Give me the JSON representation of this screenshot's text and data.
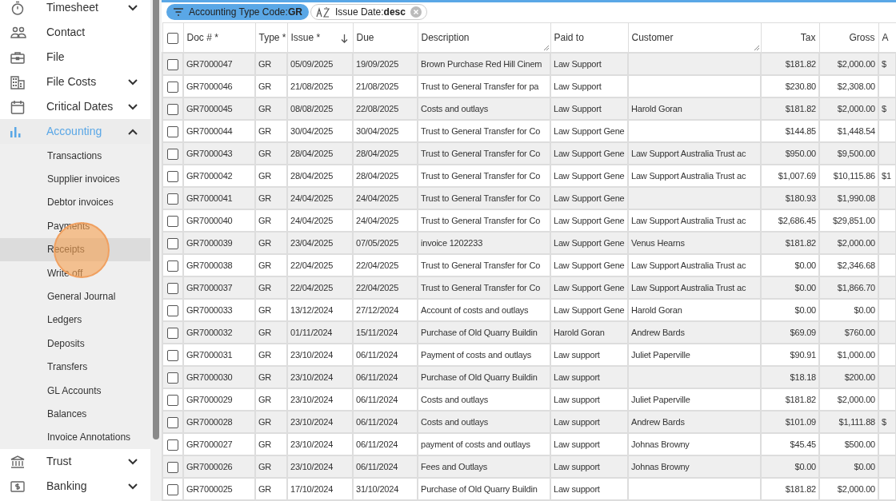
{
  "sidebar": {
    "items": [
      {
        "label": "Timesheet",
        "selected": false,
        "expanded": false
      },
      {
        "label": "Contact",
        "selected": false
      },
      {
        "label": "File",
        "selected": false
      },
      {
        "label": "File Costs",
        "selected": false,
        "expanded": false
      },
      {
        "label": "Critical Dates",
        "selected": false,
        "expanded": false
      },
      {
        "label": "Accounting",
        "selected": true,
        "expanded": true,
        "children": [
          {
            "label": "Transactions",
            "selected": false
          },
          {
            "label": "Supplier invoices",
            "selected": false
          },
          {
            "label": "Debtor invoices",
            "selected": false
          },
          {
            "label": "Payments",
            "selected": false
          },
          {
            "label": "Receipts",
            "selected": true
          },
          {
            "label": "Write off",
            "selected": false
          },
          {
            "label": "General Journal",
            "selected": false
          },
          {
            "label": "Ledgers",
            "selected": false
          },
          {
            "label": "Deposits",
            "selected": false
          },
          {
            "label": "Transfers",
            "selected": false
          },
          {
            "label": "GL Accounts",
            "selected": false
          },
          {
            "label": "Balances",
            "selected": false
          },
          {
            "label": "Invoice Annotations",
            "selected": false
          }
        ]
      },
      {
        "label": "Trust",
        "selected": false,
        "expanded": false
      },
      {
        "label": "Banking",
        "selected": false,
        "expanded": false
      }
    ]
  },
  "chips": [
    {
      "kind": "filter",
      "label": "Accounting Type Code:",
      "value": "GR"
    },
    {
      "kind": "sort",
      "label": "Issue Date:",
      "value": "desc"
    }
  ],
  "table": {
    "header_checked": false,
    "columns": [
      {
        "label": "Doc # *",
        "kind": "text",
        "sorted": false,
        "resizable": false
      },
      {
        "label": "Type *",
        "kind": "text",
        "sorted": false,
        "resizable": false
      },
      {
        "label": "Issue *",
        "kind": "text",
        "sorted": true,
        "resizable": false
      },
      {
        "label": "Due",
        "kind": "text",
        "sorted": false,
        "resizable": false
      },
      {
        "label": "Description",
        "kind": "text",
        "sorted": false,
        "resizable": true
      },
      {
        "label": "Paid to",
        "kind": "text",
        "sorted": false,
        "resizable": false
      },
      {
        "label": "Customer",
        "kind": "text",
        "sorted": false,
        "resizable": true
      },
      {
        "label": "Tax",
        "kind": "money",
        "sorted": false,
        "resizable": false
      },
      {
        "label": "Gross",
        "kind": "money",
        "sorted": false,
        "resizable": false
      },
      {
        "label": "A",
        "kind": "text",
        "sorted": false,
        "resizable": false
      }
    ],
    "rows": [
      {
        "checked": false,
        "cells": [
          "GR7000047",
          "GR",
          "05/09/2025",
          "19/09/2025",
          "Brown Purchase Red Hill Cinem",
          "Law Support",
          "",
          "$181.82",
          "$2,000.00",
          "$"
        ]
      },
      {
        "checked": false,
        "cells": [
          "GR7000046",
          "GR",
          "21/08/2025",
          "21/08/2025",
          "Trust to General Transfer for pa",
          "Law Support",
          "",
          "$230.80",
          "$2,308.00",
          ""
        ]
      },
      {
        "checked": false,
        "cells": [
          "GR7000045",
          "GR",
          "08/08/2025",
          "22/08/2025",
          "Costs and outlays",
          "Law Support",
          "Harold Goran",
          "$181.82",
          "$2,000.00",
          "$"
        ]
      },
      {
        "checked": false,
        "cells": [
          "GR7000044",
          "GR",
          "30/04/2025",
          "30/04/2025",
          "Trust to General Transfer for Co",
          "Law Support Gene",
          "",
          "$144.85",
          "$1,448.54",
          ""
        ]
      },
      {
        "checked": false,
        "cells": [
          "GR7000043",
          "GR",
          "28/04/2025",
          "28/04/2025",
          "Trust to General Transfer for Co",
          "Law Support Gene",
          "Law Support Australia Trust ac",
          "$950.00",
          "$9,500.00",
          ""
        ]
      },
      {
        "checked": false,
        "cells": [
          "GR7000042",
          "GR",
          "28/04/2025",
          "28/04/2025",
          "Trust to General Transfer for Co",
          "Law Support Gene",
          "Law Support Australia Trust ac",
          "$1,007.69",
          "$10,115.86",
          "$1"
        ]
      },
      {
        "checked": false,
        "cells": [
          "GR7000041",
          "GR",
          "24/04/2025",
          "24/04/2025",
          "Trust to General Transfer for Co",
          "Law Support Gene",
          "",
          "$180.93",
          "$1,990.08",
          ""
        ]
      },
      {
        "checked": false,
        "cells": [
          "GR7000040",
          "GR",
          "24/04/2025",
          "24/04/2025",
          "Trust to General Transfer for Co",
          "Law Support Gene",
          "Law Support Australia Trust ac",
          "$2,686.45",
          "$29,851.00",
          ""
        ]
      },
      {
        "checked": false,
        "cells": [
          "GR7000039",
          "GR",
          "23/04/2025",
          "07/05/2025",
          "invoice 1202233",
          "Law Support Gene",
          "Venus Hearns",
          "$181.82",
          "$2,000.00",
          ""
        ]
      },
      {
        "checked": false,
        "cells": [
          "GR7000038",
          "GR",
          "22/04/2025",
          "22/04/2025",
          "Trust to General Transfer for Co",
          "Law Support Gene",
          "Law Support Australia Trust ac",
          "$0.00",
          "$2,346.68",
          ""
        ]
      },
      {
        "checked": false,
        "cells": [
          "GR7000037",
          "GR",
          "22/04/2025",
          "22/04/2025",
          "Trust to General Transfer for Co",
          "Law Support Gene",
          "Law Support Australia Trust ac",
          "$0.00",
          "$1,866.70",
          ""
        ]
      },
      {
        "checked": false,
        "cells": [
          "GR7000033",
          "GR",
          "13/12/2024",
          "27/12/2024",
          "Account of costs and outlays",
          "Law Support Gene",
          "Harold Goran",
          "$0.00",
          "$0.00",
          ""
        ]
      },
      {
        "checked": false,
        "cells": [
          "GR7000032",
          "GR",
          "01/11/2024",
          "15/11/2024",
          "Purchase of Old Quarry Buildin",
          "Harold Goran",
          "Andrew Bards",
          "$69.09",
          "$760.00",
          ""
        ]
      },
      {
        "checked": false,
        "cells": [
          "GR7000031",
          "GR",
          "23/10/2024",
          "06/11/2024",
          "Payment of costs and outlays",
          "Law support",
          "Juliet Paperville",
          "$90.91",
          "$1,000.00",
          ""
        ]
      },
      {
        "checked": false,
        "cells": [
          "GR7000030",
          "GR",
          "23/10/2024",
          "06/11/2024",
          "Purchase of Old Quarry Buildin",
          "Law support",
          "",
          "$18.18",
          "$200.00",
          ""
        ]
      },
      {
        "checked": false,
        "cells": [
          "GR7000029",
          "GR",
          "23/10/2024",
          "06/11/2024",
          "Costs and outlays",
          "Law support",
          "Juliet Paperville",
          "$181.82",
          "$2,000.00",
          ""
        ]
      },
      {
        "checked": false,
        "cells": [
          "GR7000028",
          "GR",
          "23/10/2024",
          "06/11/2024",
          "Costs and outlays",
          "Law support",
          "Andrew Bards",
          "$101.09",
          "$1,111.88",
          "$"
        ]
      },
      {
        "checked": false,
        "cells": [
          "GR7000027",
          "GR",
          "23/10/2024",
          "06/11/2024",
          "payment of costs and outlays",
          "Law support",
          "Johnas Browny",
          "$45.45",
          "$500.00",
          ""
        ]
      },
      {
        "checked": false,
        "cells": [
          "GR7000026",
          "GR",
          "23/10/2024",
          "06/11/2024",
          "Fees and Outlays",
          "Law support",
          "Johnas Browny",
          "$0.00",
          "$0.00",
          ""
        ]
      },
      {
        "checked": false,
        "cells": [
          "GR7000025",
          "GR",
          "17/10/2024",
          "31/10/2024",
          "Purchase of Old Quarry Buildin",
          "Law support",
          "",
          "$181.82",
          "$2,000.00",
          ""
        ]
      }
    ]
  }
}
